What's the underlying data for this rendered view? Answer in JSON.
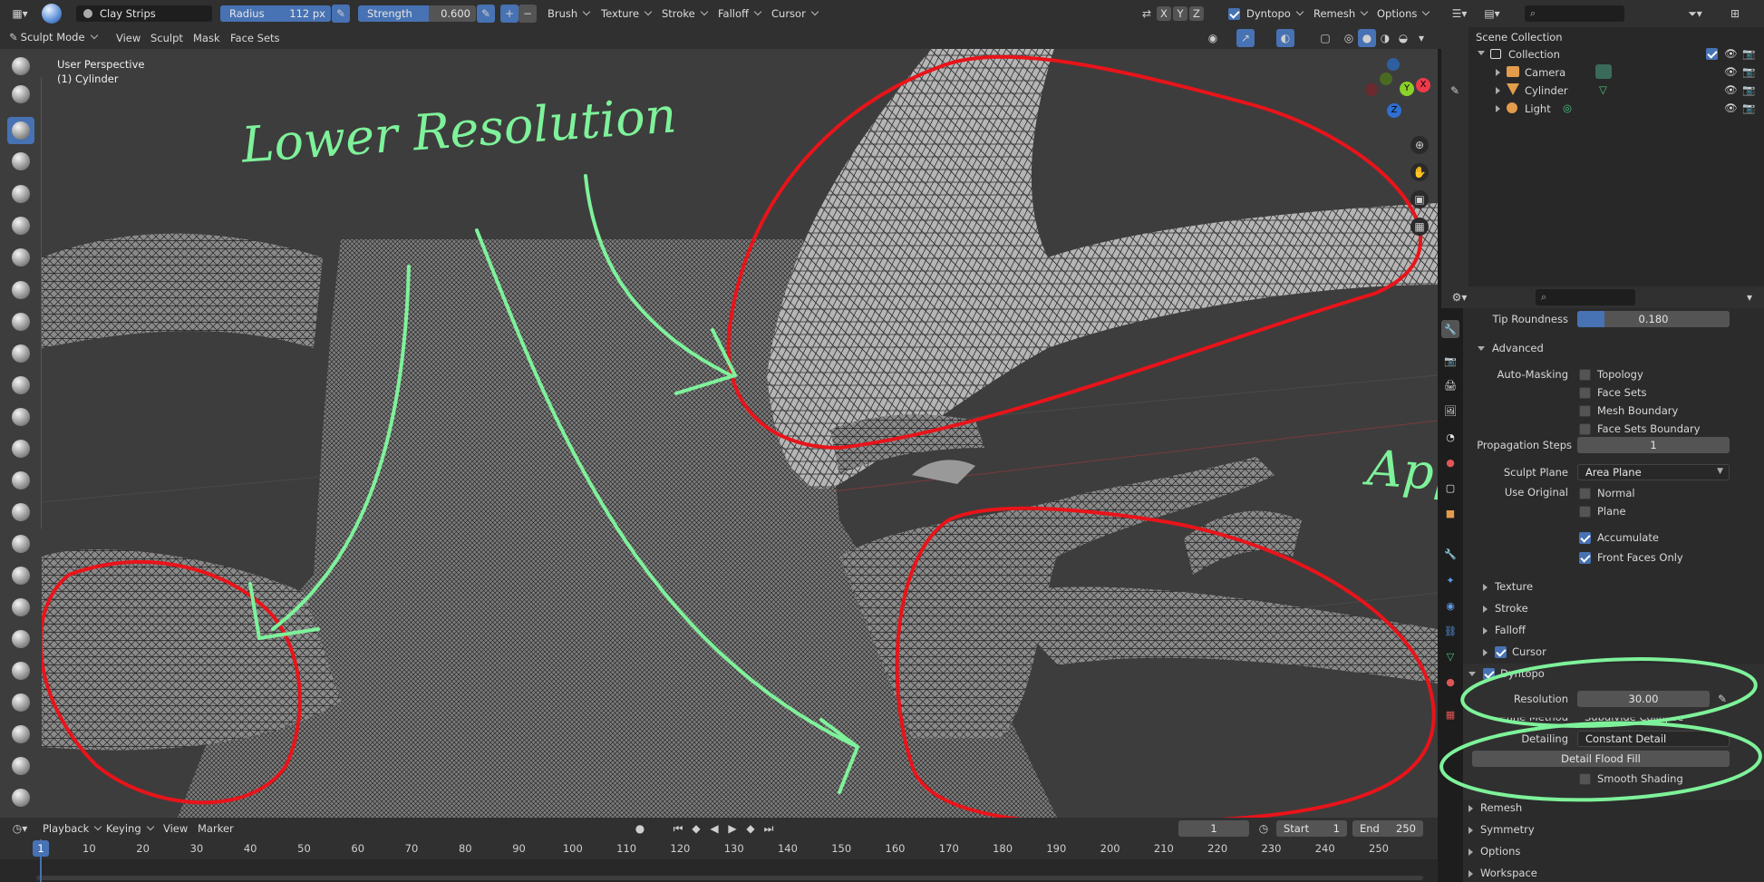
{
  "topbar": {
    "brush_name": "Clay Strips",
    "radius_label": "Radius",
    "radius_value": "112 px",
    "strength_label": "Strength",
    "strength_value": "0.600",
    "menus": [
      "Brush",
      "Texture",
      "Stroke",
      "Falloff",
      "Cursor"
    ],
    "axes": [
      "X",
      "Y",
      "Z"
    ],
    "dyntopo_label": "Dyntopo",
    "remesh_label": "Remesh",
    "options_label": "Options"
  },
  "modebar": {
    "mode": "Sculpt Mode",
    "menus": [
      "View",
      "Sculpt",
      "Mask",
      "Face Sets"
    ]
  },
  "viewport": {
    "perspective": "User Perspective",
    "object": "(1) Cylinder",
    "gizmo_axes": [
      "X",
      "Y",
      "Z"
    ]
  },
  "annotations": {
    "top_note": "Lower Resolution",
    "right_note": "Apply this"
  },
  "outliner": {
    "root": "Scene Collection",
    "collection": "Collection",
    "items": [
      "Camera",
      "Cylinder",
      "Light"
    ]
  },
  "properties": {
    "tip_roundness_label": "Tip Roundness",
    "tip_roundness_value": "0.180",
    "tip_roundness_fraction": 0.18,
    "advanced_label": "Advanced",
    "auto_masking_label": "Auto-Masking",
    "auto_masking_options": [
      {
        "label": "Topology",
        "checked": false
      },
      {
        "label": "Face Sets",
        "checked": false
      },
      {
        "label": "Mesh Boundary",
        "checked": false
      },
      {
        "label": "Face Sets Boundary",
        "checked": false
      }
    ],
    "propagation_label": "Propagation Steps",
    "propagation_value": "1",
    "sculpt_plane_label": "Sculpt Plane",
    "sculpt_plane_value": "Area Plane",
    "use_original_label": "Use Original",
    "use_original_options": [
      {
        "label": "Normal",
        "checked": false
      },
      {
        "label": "Plane",
        "checked": false
      }
    ],
    "accumulate_label": "Accumulate",
    "front_faces_label": "Front Faces Only",
    "collapsed_sections": [
      "Texture",
      "Stroke",
      "Falloff"
    ],
    "cursor_label": "Cursor",
    "dyntopo_label": "Dyntopo",
    "resolution_label": "Resolution",
    "resolution_value": "30.00",
    "refine_label": "Refine Method",
    "refine_value": "Subdivide Collapse",
    "detailing_label": "Detailing",
    "detailing_value": "Constant Detail",
    "flood_fill_label": "Detail Flood Fill",
    "smooth_shading_label": "Smooth Shading",
    "bottom_sections": [
      "Remesh",
      "Symmetry",
      "Options",
      "Workspace"
    ]
  },
  "timeline": {
    "menus": [
      "Playback",
      "Keying",
      "View",
      "Marker"
    ],
    "current_frame": "1",
    "start_label": "Start",
    "start_value": "1",
    "end_label": "End",
    "end_value": "250",
    "ticks": [
      "1",
      "10",
      "20",
      "30",
      "40",
      "50",
      "60",
      "70",
      "80",
      "90",
      "100",
      "110",
      "120",
      "130",
      "140",
      "150",
      "160",
      "170",
      "180",
      "190",
      "200",
      "210",
      "220",
      "230",
      "240",
      "250"
    ]
  },
  "colors": {
    "accent": "#4772b3",
    "red_annotation": "#e8141a",
    "green_annotation": "#7ef29a",
    "viewport_bg": "#3d3d3d"
  }
}
